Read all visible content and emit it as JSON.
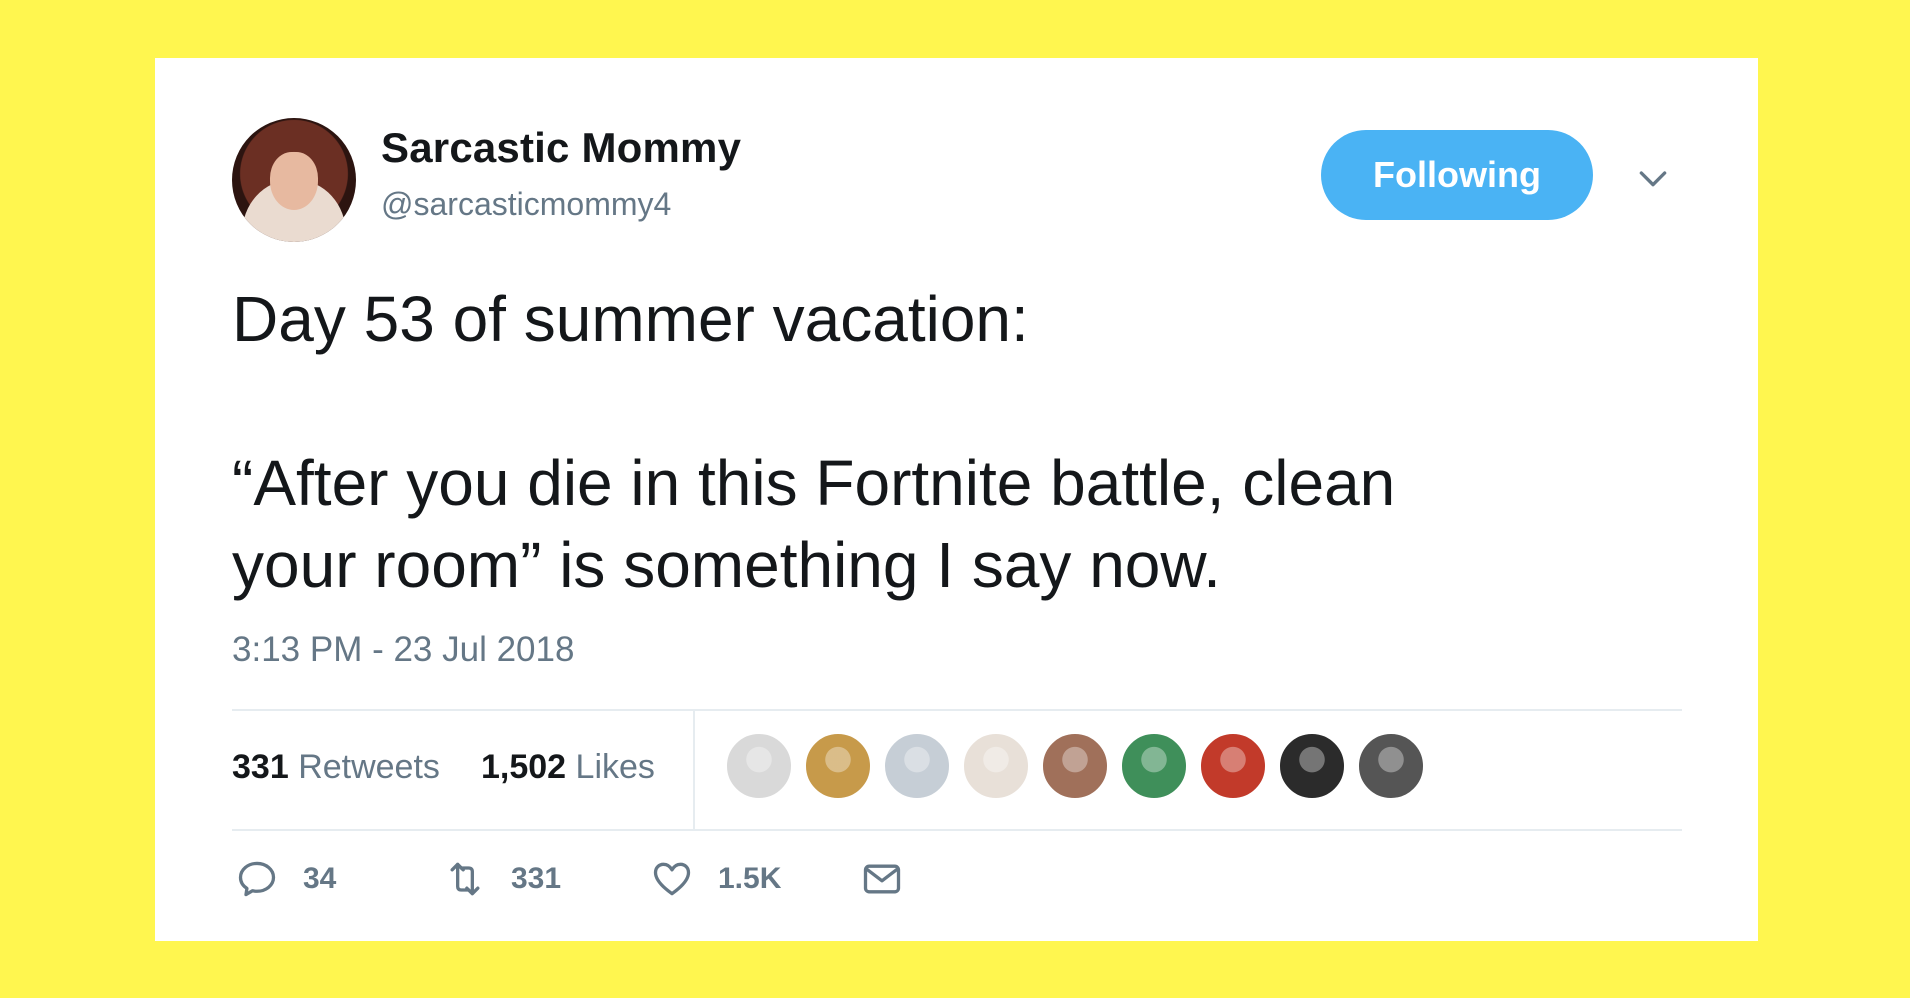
{
  "user": {
    "display_name": "Sarcastic Mommy",
    "handle": "@sarcasticmommy4"
  },
  "follow_button": {
    "label": "Following"
  },
  "tweet": {
    "text": "Day 53 of summer vacation:\n\n“After you die in this Fortnite battle, clean\nyour room” is something I say now.",
    "timestamp": "3:13 PM - 23 Jul 2018"
  },
  "stats": {
    "retweets_count": "331",
    "retweets_label": "Retweets",
    "likes_count": "1,502",
    "likes_label": "Likes"
  },
  "liker_avatars": [
    {
      "name": "liker-1",
      "color": "#d9d9d9"
    },
    {
      "name": "liker-2",
      "color": "#c79a4a"
    },
    {
      "name": "liker-3",
      "color": "#c6ced6"
    },
    {
      "name": "liker-4",
      "color": "#e8e0d8"
    },
    {
      "name": "liker-5",
      "color": "#a0705a"
    },
    {
      "name": "liker-6",
      "color": "#3f8f5a"
    },
    {
      "name": "liker-7",
      "color": "#c23a2a"
    },
    {
      "name": "liker-8",
      "color": "#2b2b2b"
    },
    {
      "name": "liker-9",
      "color": "#555555"
    }
  ],
  "actions": {
    "reply_count": "34",
    "retweet_count": "331",
    "like_count": "1.5K"
  },
  "colors": {
    "background": "#FFF64F",
    "accent": "#4AB3F4",
    "text_primary": "#14171A",
    "text_secondary": "#657786",
    "divider": "#E6ECF0"
  },
  "icons": {
    "reply": "reply-icon",
    "retweet": "retweet-icon",
    "like": "heart-icon",
    "message": "envelope-icon",
    "menu": "chevron-down-icon"
  }
}
